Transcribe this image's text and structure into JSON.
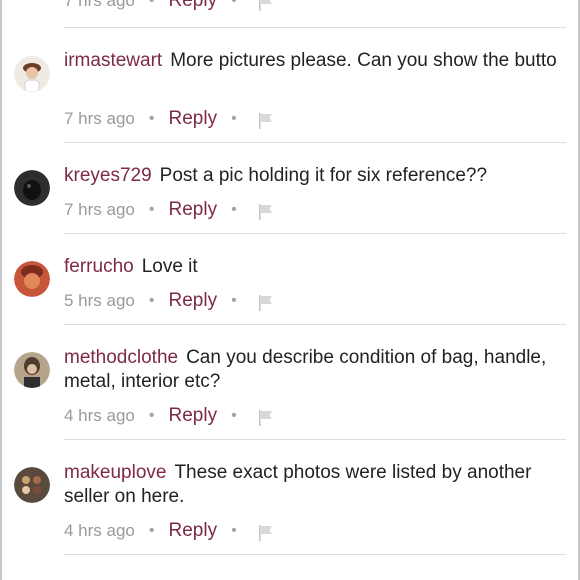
{
  "comments": [
    {
      "username": "irmastewart",
      "text": "More pictures please. Can you show the butto",
      "time": "7 hrs ago",
      "reply": "Reply",
      "avatar": {
        "bg": "#f3efe9",
        "accent": "#6e3b2a"
      }
    },
    {
      "username": "kreyes729",
      "text": "Post a pic holding it for six reference??",
      "time": "7 hrs ago",
      "reply": "Reply",
      "avatar": {
        "bg": "#3a3a3a",
        "accent": "#111111"
      }
    },
    {
      "username": "ferrucho",
      "text": "Love it",
      "time": "5 hrs ago",
      "reply": "Reply",
      "avatar": {
        "bg": "#c7553a",
        "accent": "#7b2d1e"
      }
    },
    {
      "username": "methodclothe",
      "text": "Can you describe condition of bag, handle, metal, interior etc?",
      "time": "4 hrs ago",
      "reply": "Reply",
      "avatar": {
        "bg": "#9f8a71",
        "accent": "#4e3d2f"
      }
    },
    {
      "username": "makeuplove",
      "text": "These exact photos were listed by another seller on here.",
      "time": "4 hrs ago",
      "reply": "Reply",
      "avatar": {
        "bg": "#5a4a3e",
        "accent": "#c9a46b"
      }
    }
  ],
  "top_partial": {
    "time": "7 hrs ago",
    "reply": "Reply"
  },
  "colors": {
    "accent": "#7d2a45",
    "meta": "#9a9a9a",
    "divider": "#dcdcdc"
  },
  "icons": {
    "flag": "flag-icon",
    "separator": "dot-separator"
  }
}
